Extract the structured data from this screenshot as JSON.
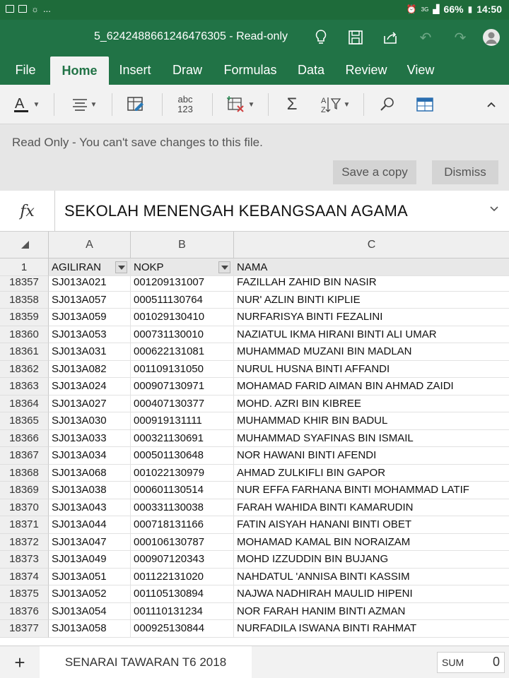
{
  "status_bar": {
    "dots": "...",
    "network": "3G",
    "battery": "66%",
    "time": "14:50"
  },
  "title_bar": {
    "doc_title": "5_6242488661246476305 - Read-only"
  },
  "tabs": [
    "File",
    "Home",
    "Insert",
    "Draw",
    "Formulas",
    "Data",
    "Review",
    "View"
  ],
  "ribbon": {
    "number_format_label_top": "abc",
    "number_format_label_bottom": "123"
  },
  "message_bar": {
    "text": "Read Only - You can't save changes to this file.",
    "save_copy": "Save a copy",
    "dismiss": "Dismiss"
  },
  "formula_bar": {
    "fx": "fx",
    "value": "SEKOLAH MENENGAH KEBANGSAAN AGAMA"
  },
  "columns": [
    "A",
    "B",
    "C"
  ],
  "header_row": {
    "num": "1",
    "cells": [
      "AGILIRAN",
      "NOKP",
      "NAMA"
    ]
  },
  "rows": [
    {
      "num": "18357",
      "a": "SJ013A021",
      "b": "001209131007",
      "c": "FAZILLAH ZAHID BIN NASIR"
    },
    {
      "num": "18358",
      "a": "SJ013A057",
      "b": "000511130764",
      "c": "NUR' AZLIN BINTI KIPLIE"
    },
    {
      "num": "18359",
      "a": "SJ013A059",
      "b": "001029130410",
      "c": "NURFARISYA BINTI FEZALINI"
    },
    {
      "num": "18360",
      "a": "SJ013A053",
      "b": "000731130010",
      "c": "NAZIATUL IKMA HIRANI BINTI ALI UMAR"
    },
    {
      "num": "18361",
      "a": "SJ013A031",
      "b": "000622131081",
      "c": "MUHAMMAD MUZANI BIN MADLAN"
    },
    {
      "num": "18362",
      "a": "SJ013A082",
      "b": "001109131050",
      "c": "NURUL HUSNA BINTI AFFANDI"
    },
    {
      "num": "18363",
      "a": "SJ013A024",
      "b": "000907130971",
      "c": "MOHAMAD FARID AIMAN BIN AHMAD ZAIDI"
    },
    {
      "num": "18364",
      "a": "SJ013A027",
      "b": "000407130377",
      "c": "MOHD. AZRI BIN KIBREE"
    },
    {
      "num": "18365",
      "a": "SJ013A030",
      "b": "000919131111",
      "c": "MUHAMMAD KHIR BIN BADUL"
    },
    {
      "num": "18366",
      "a": "SJ013A033",
      "b": "000321130691",
      "c": "MUHAMMAD SYAFINAS BIN ISMAIL"
    },
    {
      "num": "18367",
      "a": "SJ013A034",
      "b": "000501130648",
      "c": "NOR HAWANI BINTI AFENDI"
    },
    {
      "num": "18368",
      "a": "SJ013A068",
      "b": "001022130979",
      "c": "AHMAD ZULKIFLI BIN GAPOR"
    },
    {
      "num": "18369",
      "a": "SJ013A038",
      "b": "000601130514",
      "c": "NUR EFFA FARHANA BINTI MOHAMMAD LATIF"
    },
    {
      "num": "18370",
      "a": "SJ013A043",
      "b": "000331130038",
      "c": "FARAH WAHIDA BINTI KAMARUDIN"
    },
    {
      "num": "18371",
      "a": "SJ013A044",
      "b": "000718131166",
      "c": "FATIN AISYAH HANANI BINTI OBET"
    },
    {
      "num": "18372",
      "a": "SJ013A047",
      "b": "000106130787",
      "c": "MOHAMAD KAMAL BIN NORAIZAM"
    },
    {
      "num": "18373",
      "a": "SJ013A049",
      "b": "000907120343",
      "c": "MOHD IZZUDDIN BIN BUJANG"
    },
    {
      "num": "18374",
      "a": "SJ013A051",
      "b": "001122131020",
      "c": "NAHDATUL 'ANNISA BINTI KASSIM"
    },
    {
      "num": "18375",
      "a": "SJ013A052",
      "b": "001105130894",
      "c": "NAJWA NADHIRAH MAULID HIPENI"
    },
    {
      "num": "18376",
      "a": "SJ013A054",
      "b": "001110131234",
      "c": "NOR FARAH HANIM BINTI AZMAN"
    },
    {
      "num": "18377",
      "a": "SJ013A058",
      "b": "000925130844",
      "c": "NURFADILA ISWANA BINTI RAHMAT"
    }
  ],
  "sheet_bar": {
    "add": "+",
    "sheet_name": "SENARAI TAWARAN T6 2018",
    "sum_label": "SUM",
    "sum_value": "0"
  },
  "colors": {
    "excel_green": "#217346",
    "status_green": "#1e6b3a"
  }
}
